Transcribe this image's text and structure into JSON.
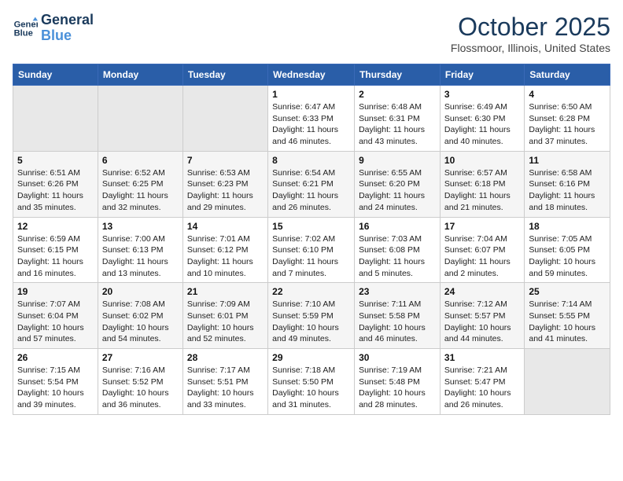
{
  "logo": {
    "line1": "General",
    "line2": "Blue"
  },
  "title": "October 2025",
  "location": "Flossmoor, Illinois, United States",
  "weekdays": [
    "Sunday",
    "Monday",
    "Tuesday",
    "Wednesday",
    "Thursday",
    "Friday",
    "Saturday"
  ],
  "weeks": [
    [
      {
        "day": "",
        "info": ""
      },
      {
        "day": "",
        "info": ""
      },
      {
        "day": "",
        "info": ""
      },
      {
        "day": "1",
        "info": "Sunrise: 6:47 AM\nSunset: 6:33 PM\nDaylight: 11 hours and 46 minutes."
      },
      {
        "day": "2",
        "info": "Sunrise: 6:48 AM\nSunset: 6:31 PM\nDaylight: 11 hours and 43 minutes."
      },
      {
        "day": "3",
        "info": "Sunrise: 6:49 AM\nSunset: 6:30 PM\nDaylight: 11 hours and 40 minutes."
      },
      {
        "day": "4",
        "info": "Sunrise: 6:50 AM\nSunset: 6:28 PM\nDaylight: 11 hours and 37 minutes."
      }
    ],
    [
      {
        "day": "5",
        "info": "Sunrise: 6:51 AM\nSunset: 6:26 PM\nDaylight: 11 hours and 35 minutes."
      },
      {
        "day": "6",
        "info": "Sunrise: 6:52 AM\nSunset: 6:25 PM\nDaylight: 11 hours and 32 minutes."
      },
      {
        "day": "7",
        "info": "Sunrise: 6:53 AM\nSunset: 6:23 PM\nDaylight: 11 hours and 29 minutes."
      },
      {
        "day": "8",
        "info": "Sunrise: 6:54 AM\nSunset: 6:21 PM\nDaylight: 11 hours and 26 minutes."
      },
      {
        "day": "9",
        "info": "Sunrise: 6:55 AM\nSunset: 6:20 PM\nDaylight: 11 hours and 24 minutes."
      },
      {
        "day": "10",
        "info": "Sunrise: 6:57 AM\nSunset: 6:18 PM\nDaylight: 11 hours and 21 minutes."
      },
      {
        "day": "11",
        "info": "Sunrise: 6:58 AM\nSunset: 6:16 PM\nDaylight: 11 hours and 18 minutes."
      }
    ],
    [
      {
        "day": "12",
        "info": "Sunrise: 6:59 AM\nSunset: 6:15 PM\nDaylight: 11 hours and 16 minutes."
      },
      {
        "day": "13",
        "info": "Sunrise: 7:00 AM\nSunset: 6:13 PM\nDaylight: 11 hours and 13 minutes."
      },
      {
        "day": "14",
        "info": "Sunrise: 7:01 AM\nSunset: 6:12 PM\nDaylight: 11 hours and 10 minutes."
      },
      {
        "day": "15",
        "info": "Sunrise: 7:02 AM\nSunset: 6:10 PM\nDaylight: 11 hours and 7 minutes."
      },
      {
        "day": "16",
        "info": "Sunrise: 7:03 AM\nSunset: 6:08 PM\nDaylight: 11 hours and 5 minutes."
      },
      {
        "day": "17",
        "info": "Sunrise: 7:04 AM\nSunset: 6:07 PM\nDaylight: 11 hours and 2 minutes."
      },
      {
        "day": "18",
        "info": "Sunrise: 7:05 AM\nSunset: 6:05 PM\nDaylight: 10 hours and 59 minutes."
      }
    ],
    [
      {
        "day": "19",
        "info": "Sunrise: 7:07 AM\nSunset: 6:04 PM\nDaylight: 10 hours and 57 minutes."
      },
      {
        "day": "20",
        "info": "Sunrise: 7:08 AM\nSunset: 6:02 PM\nDaylight: 10 hours and 54 minutes."
      },
      {
        "day": "21",
        "info": "Sunrise: 7:09 AM\nSunset: 6:01 PM\nDaylight: 10 hours and 52 minutes."
      },
      {
        "day": "22",
        "info": "Sunrise: 7:10 AM\nSunset: 5:59 PM\nDaylight: 10 hours and 49 minutes."
      },
      {
        "day": "23",
        "info": "Sunrise: 7:11 AM\nSunset: 5:58 PM\nDaylight: 10 hours and 46 minutes."
      },
      {
        "day": "24",
        "info": "Sunrise: 7:12 AM\nSunset: 5:57 PM\nDaylight: 10 hours and 44 minutes."
      },
      {
        "day": "25",
        "info": "Sunrise: 7:14 AM\nSunset: 5:55 PM\nDaylight: 10 hours and 41 minutes."
      }
    ],
    [
      {
        "day": "26",
        "info": "Sunrise: 7:15 AM\nSunset: 5:54 PM\nDaylight: 10 hours and 39 minutes."
      },
      {
        "day": "27",
        "info": "Sunrise: 7:16 AM\nSunset: 5:52 PM\nDaylight: 10 hours and 36 minutes."
      },
      {
        "day": "28",
        "info": "Sunrise: 7:17 AM\nSunset: 5:51 PM\nDaylight: 10 hours and 33 minutes."
      },
      {
        "day": "29",
        "info": "Sunrise: 7:18 AM\nSunset: 5:50 PM\nDaylight: 10 hours and 31 minutes."
      },
      {
        "day": "30",
        "info": "Sunrise: 7:19 AM\nSunset: 5:48 PM\nDaylight: 10 hours and 28 minutes."
      },
      {
        "day": "31",
        "info": "Sunrise: 7:21 AM\nSunset: 5:47 PM\nDaylight: 10 hours and 26 minutes."
      },
      {
        "day": "",
        "info": ""
      }
    ]
  ]
}
